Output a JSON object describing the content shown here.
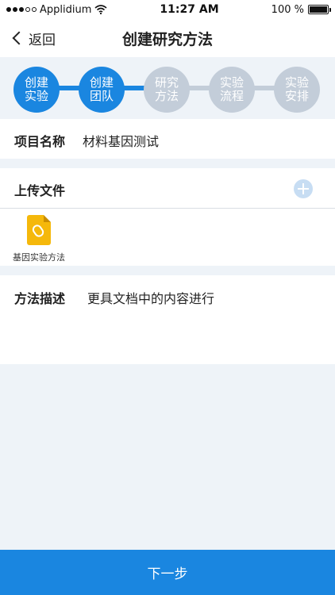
{
  "status_bar": {
    "carrier": "Applidium",
    "time": "11:27 AM",
    "battery": "100 %",
    "battery_level": 1.0,
    "signal_bars_filled": 3,
    "signal_bars_total": 5
  },
  "nav": {
    "back_label": "返回",
    "title": "创建研究方法"
  },
  "stepper": {
    "active_color": "#1a86e0",
    "inactive_color": "#c3cdd9",
    "steps": [
      {
        "label": "创建\n实验",
        "state": "active"
      },
      {
        "label": "创建\n团队",
        "state": "active"
      },
      {
        "label": "研究\n方法",
        "state": "inactive"
      },
      {
        "label": "实验\n流程",
        "state": "inactive"
      },
      {
        "label": "实验\n安排",
        "state": "inactive"
      }
    ]
  },
  "project": {
    "label": "项目名称",
    "value": "材料基因测试"
  },
  "upload": {
    "label": "上传文件",
    "add_icon": "plus-circle-icon",
    "files": [
      {
        "name": "基因实验方法",
        "icon": "paperclip-document-icon"
      }
    ]
  },
  "description": {
    "label": "方法描述",
    "value": "更具文档中的内容进行"
  },
  "footer": {
    "next_label": "下一步"
  }
}
